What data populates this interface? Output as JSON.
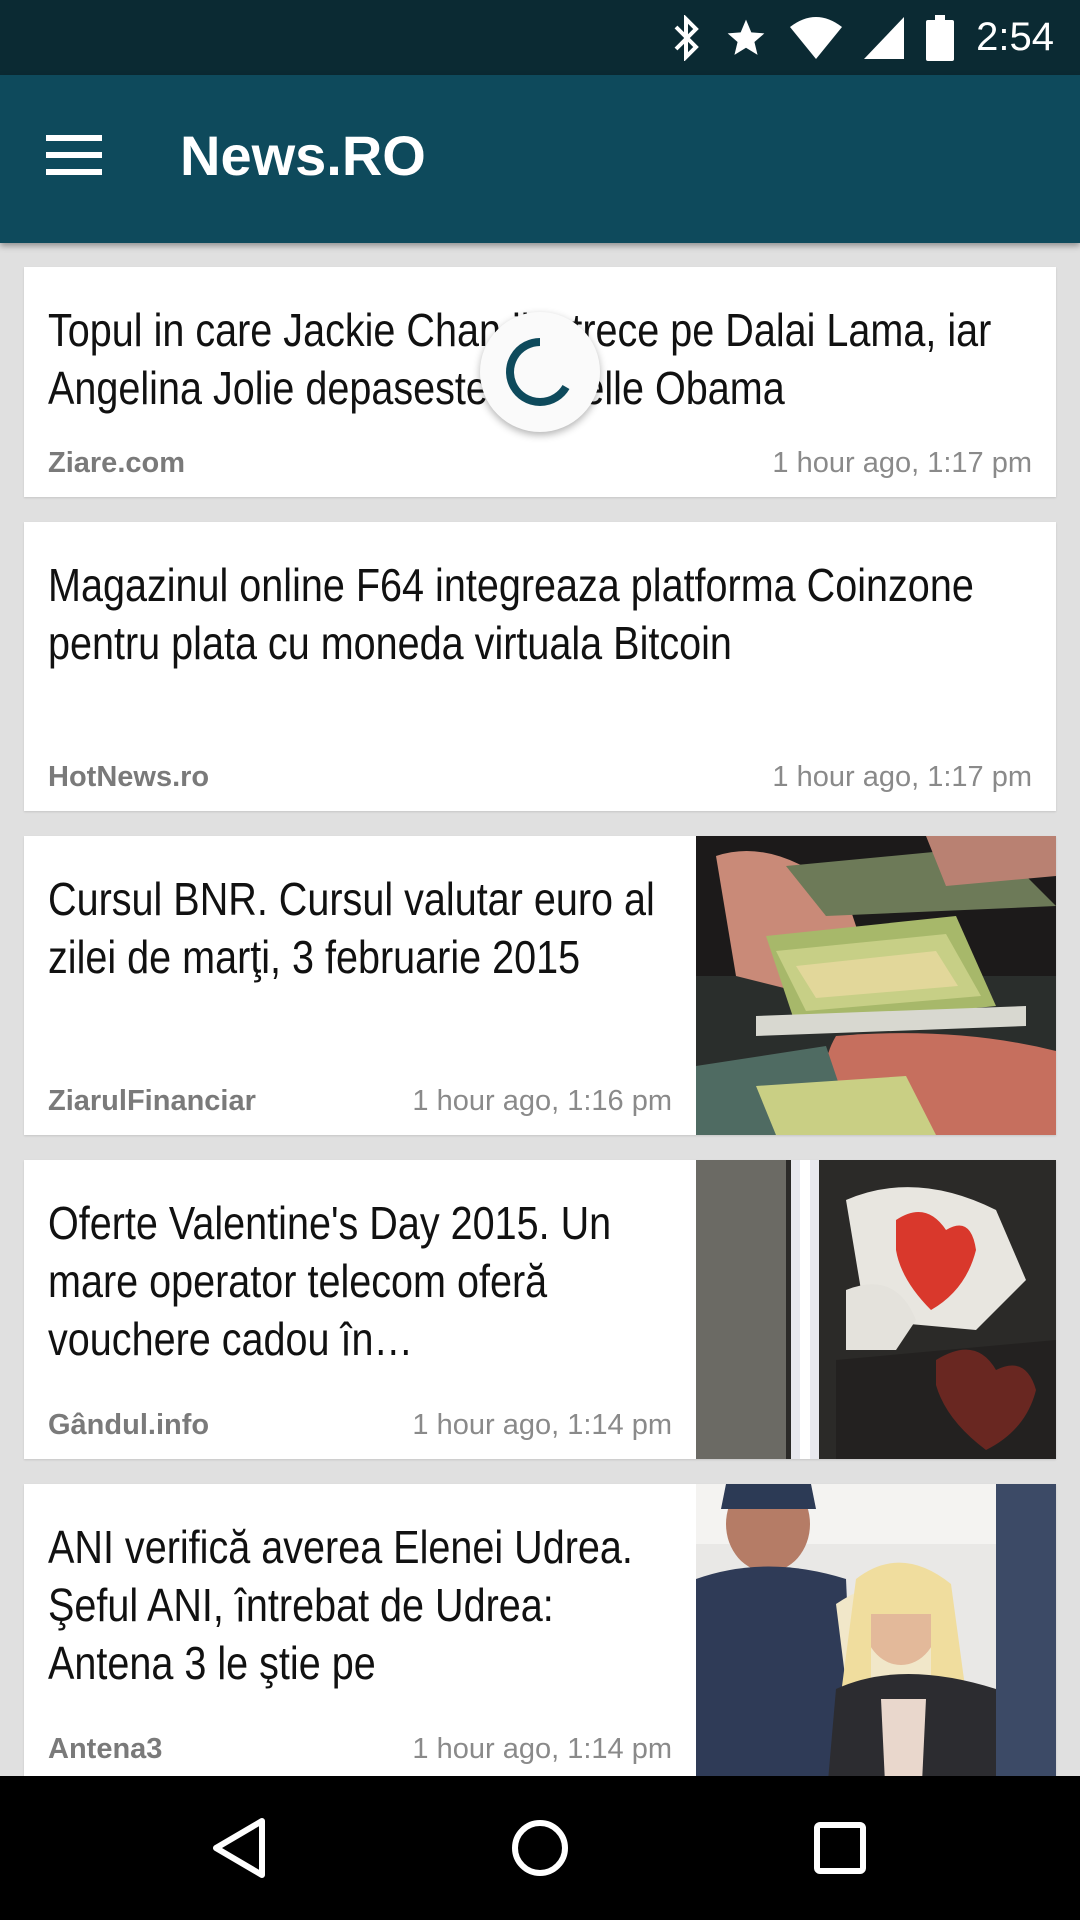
{
  "status_bar": {
    "time": "2:54",
    "icons": [
      "bluetooth-icon",
      "star-icon",
      "wifi-icon",
      "signal-icon",
      "battery-icon"
    ]
  },
  "app_bar": {
    "title": "News.RO",
    "menu_icon": "hamburger-menu-icon"
  },
  "colors": {
    "status_bar": "#0b2a33",
    "app_bar": "#0e4a5c",
    "background": "#e0e0e0",
    "spinner": "#0e4a5c"
  },
  "loading_indicator": "spinner",
  "articles": [
    {
      "headline": "Topul in care Jackie Chan il intrece pe Dalai Lama, iar Angelina Jolie depaseste Michelle Obama",
      "source": "Ziare.com",
      "time": "1 hour ago, 1:17 pm",
      "has_image": false
    },
    {
      "headline": "Magazinul online F64 integreaza platforma Coinzone pentru plata cu moneda virtuala Bitcoin",
      "source": "HotNews.ro",
      "time": "1 hour ago, 1:17 pm",
      "has_image": false
    },
    {
      "headline": "Cursul BNR. Cursul valutar euro al zilei de marţi, 3 februarie 2015",
      "source": "ZiarulFinanciar",
      "time": "1 hour ago, 1:16 pm",
      "has_image": true
    },
    {
      "headline": "Oferte Valentine's Day 2015. Un mare operator telecom oferă vouchere cadou în…",
      "source": "Gândul.info",
      "time": "1 hour ago, 1:14 pm",
      "has_image": true
    },
    {
      "headline": "ANI verifică averea Elenei Udrea. Şeful ANI, întrebat de Udrea: Antena 3 le ştie pe",
      "source": "Antena3",
      "time": "1 hour ago, 1:14 pm",
      "has_image": true
    }
  ],
  "nav_bar": {
    "buttons": [
      "back-icon",
      "home-icon",
      "recents-icon"
    ]
  }
}
